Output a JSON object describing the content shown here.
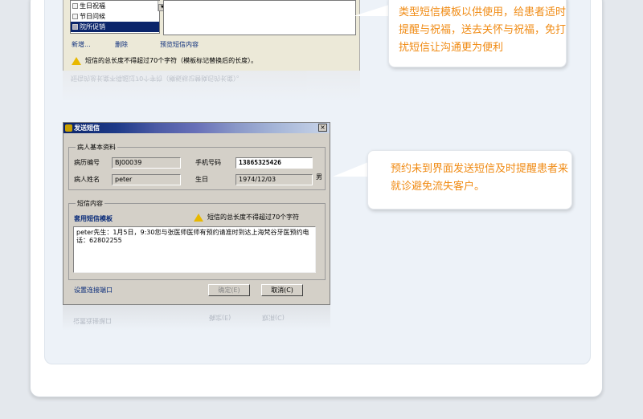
{
  "templates_panel": {
    "list_items": [
      "生日祝福",
      "节日问候",
      "院所促销"
    ],
    "links": {
      "add": "新增...",
      "delete": "删除",
      "preview": "预览短信内容"
    },
    "warning": "短信的总长度不得超过70个字符（模板标记替换后的长度）。"
  },
  "callouts": {
    "templates": "类型短信模板以供使用，给患者适时提醒与祝福，送去关怀与祝福，免打扰短信让沟通更为便利",
    "send": "预约未到界面发送短信及时提醒患者来就诊避免流失客户。"
  },
  "send_dialog": {
    "title": "发送短信",
    "close": "×",
    "patient_group": "病人基本资料",
    "record_no_label": "病历编号",
    "record_no": "BJ00039",
    "phone_label": "手机号码",
    "phone": "13865325426",
    "name_label": "病人姓名",
    "name": "peter",
    "birth_label": "生日",
    "birth": "1974/12/03",
    "gender": "男",
    "content_group": "短信内容",
    "templates_link": "套用短信模板",
    "length_warning": "短信的总长度不得超过70个字符",
    "message": "peter先生：1月5日，9:30您与张医师医师有预约请准时到达上海梵谷牙医预约电话：62802255",
    "port_link": "设置连接端口",
    "ok_button": "确定(E)",
    "cancel_button": "取消(C)"
  },
  "colors": {
    "accent": "#f08a12",
    "titlebar": "#0a246a",
    "link": "#0a2c7a"
  }
}
